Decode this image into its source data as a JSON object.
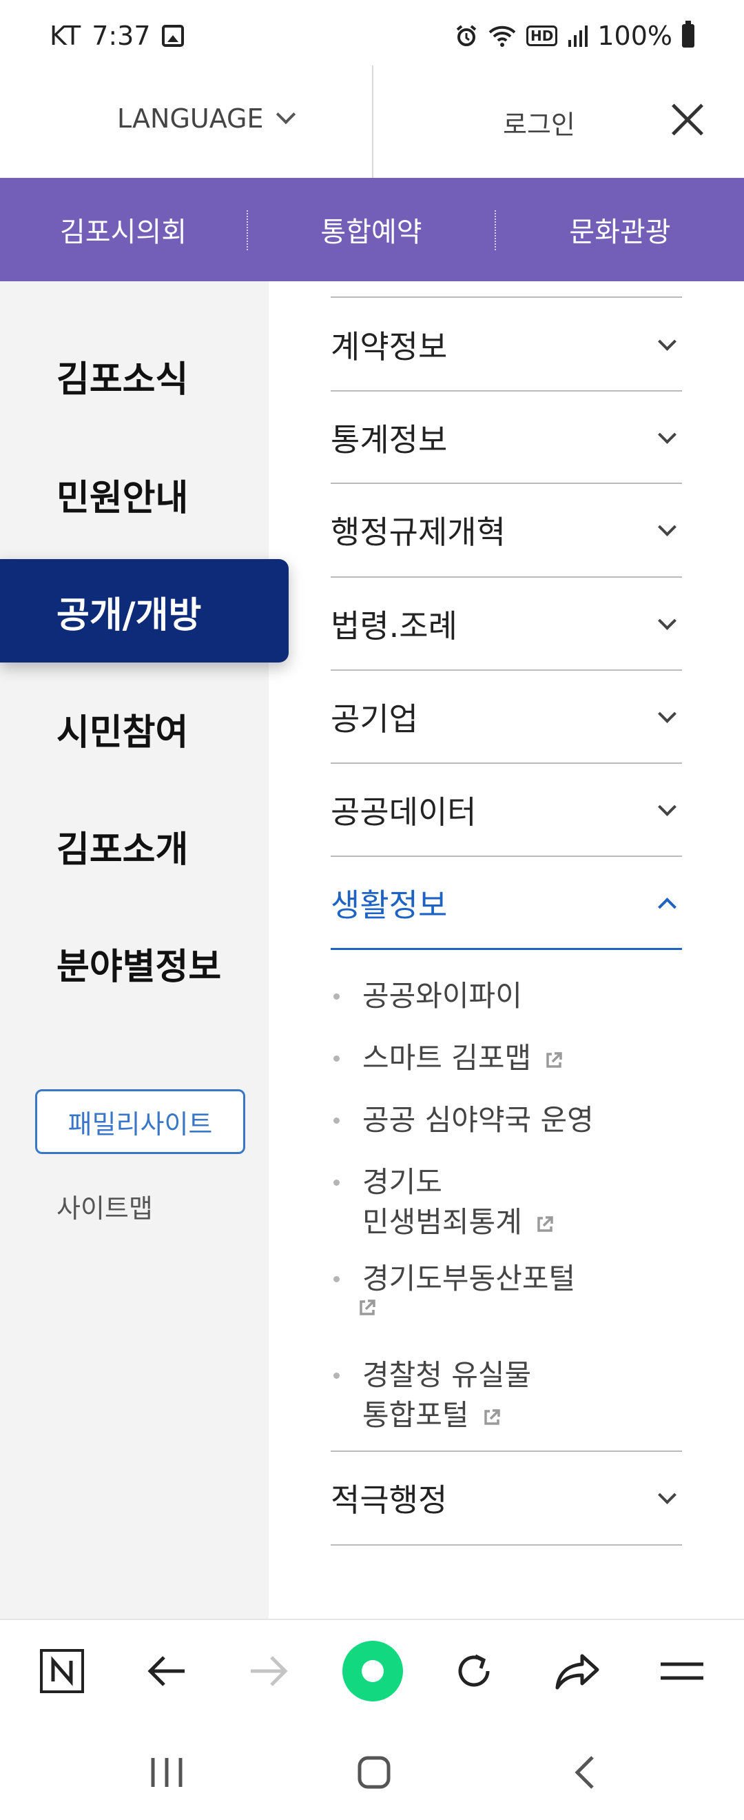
{
  "status_bar": {
    "carrier": "KT",
    "time": "7:37",
    "hd_label": "HD",
    "battery": "100%",
    "icons": [
      "image-icon",
      "alarm-icon",
      "wifi-icon",
      "hd-icon",
      "signal-icon",
      "battery-icon"
    ]
  },
  "header": {
    "language_label": "LANGUAGE",
    "login_label": "로그인",
    "close_icon": "close-icon"
  },
  "purple_bar": {
    "items": [
      "김포시의회",
      "통합예약",
      "문화관광"
    ],
    "color": "#735fb8"
  },
  "left_nav": {
    "items": [
      "김포소식",
      "민원안내",
      "공개/개방",
      "시민참여",
      "김포소개",
      "분야별정보"
    ],
    "active_index": 2,
    "active_color": "#0d2b78",
    "family_site_label": "패밀리사이트",
    "sitemap_label": "사이트맵"
  },
  "menu": {
    "items": [
      {
        "label": "계약정보",
        "expanded": false
      },
      {
        "label": "통계정보",
        "expanded": false
      },
      {
        "label": "행정규제개혁",
        "expanded": false
      },
      {
        "label": "법령.조례",
        "expanded": false
      },
      {
        "label": "공기업",
        "expanded": false
      },
      {
        "label": "공공데이터",
        "expanded": false
      },
      {
        "label": "생활정보",
        "expanded": true
      },
      {
        "label": "적극행정",
        "expanded": false
      }
    ],
    "accent_color": "#1e63c4",
    "subitems": [
      {
        "line1": "공공와이파이",
        "line2": "",
        "external": false
      },
      {
        "line1": "스마트 김포맵",
        "line2": "",
        "external": true
      },
      {
        "line1": "공공 심야약국 운영",
        "line2": "",
        "external": false
      },
      {
        "line1": "경기도",
        "line2": "민생범죄통계",
        "external": true
      },
      {
        "line1": "경기도부동산포털",
        "line2": "",
        "external": true
      },
      {
        "line1": "경찰청 유실물",
        "line2": "통합포털",
        "external": true
      }
    ]
  },
  "browser_toolbar": {
    "icons": [
      "naver-icon",
      "back-arrow-icon",
      "forward-arrow-icon",
      "whale-home-icon",
      "refresh-icon",
      "share-icon",
      "menu-icon"
    ]
  },
  "system_nav": {
    "icons": [
      "recent-apps-icon",
      "home-icon",
      "back-icon"
    ]
  }
}
